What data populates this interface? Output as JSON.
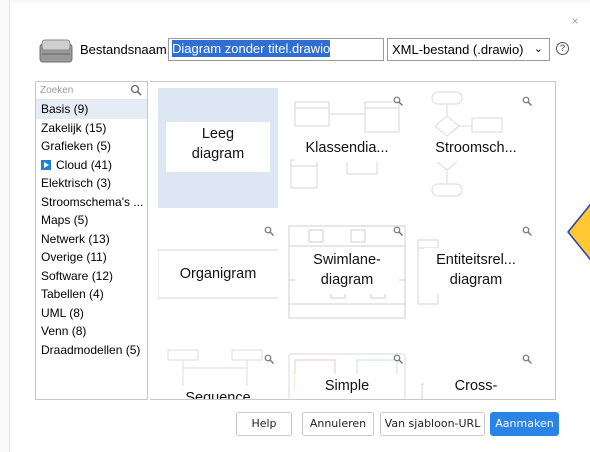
{
  "dialog": {
    "close_glyph": "×",
    "filename_label": "Bestandsnaam:",
    "filename_value": "Diagram zonder titel.drawio",
    "format_value": "XML-bestand (.drawio)",
    "format_chevron": "⌄",
    "help_glyph": "?"
  },
  "sidebar": {
    "search_placeholder": "Zoeken",
    "categories": [
      {
        "label": "Basis (9)",
        "selected": true
      },
      {
        "label": "Zakelijk (15)"
      },
      {
        "label": "Grafieken (5)"
      },
      {
        "label": "Cloud (41)",
        "icon": "cloud-badge-icon"
      },
      {
        "label": "Elektrisch (3)"
      },
      {
        "label": "Stroomschema's ..."
      },
      {
        "label": "Maps (5)"
      },
      {
        "label": "Netwerk (13)"
      },
      {
        "label": "Overige (11)"
      },
      {
        "label": "Software (12)"
      },
      {
        "label": "Tabellen (4)"
      },
      {
        "label": "UML (8)"
      },
      {
        "label": "Venn (8)"
      },
      {
        "label": "Draadmodellen (5)"
      }
    ]
  },
  "templates": [
    {
      "label": "Leeg diagram",
      "line1": "Leeg",
      "line2": "diagram",
      "selected": true
    },
    {
      "label": "Klassendia..."
    },
    {
      "label": "Stroomsch..."
    },
    {
      "label": "Organigram"
    },
    {
      "label": "Swimlane-diagram",
      "line1": "Swimlane-",
      "line2": "diagram"
    },
    {
      "label": "Entiteitsrel... diagram",
      "line1": "Entiteitsrel...",
      "line2": "diagram"
    },
    {
      "label": "Sequence"
    },
    {
      "label": "Simple"
    },
    {
      "label": "Cross-"
    }
  ],
  "buttons": {
    "help": "Help",
    "cancel": "Annuleren",
    "from_url": "Van sjabloon-URL",
    "create": "Aanmaken"
  },
  "colors": {
    "accent": "#2a83e6",
    "selection": "#dde6f3",
    "tooltip": "#ffc832"
  },
  "icons": [
    "file-icon",
    "search-icon",
    "close-icon",
    "help-icon",
    "magnify-icon",
    "cloud-badge-icon"
  ]
}
